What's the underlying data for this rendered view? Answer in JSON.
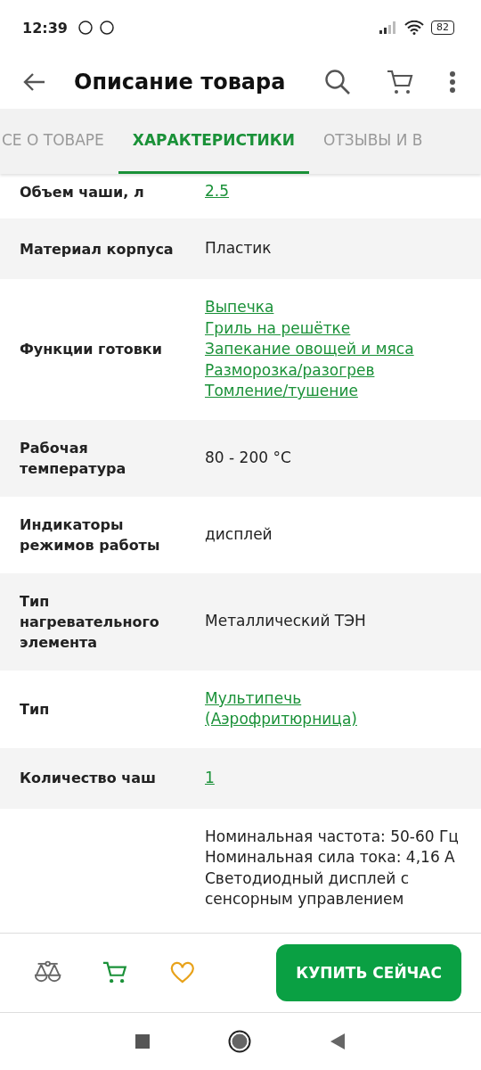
{
  "status_bar": {
    "time": "12:39",
    "battery": "82"
  },
  "app_bar": {
    "title": "Описание товара"
  },
  "tabs": [
    {
      "label": "СЕ О ТОВАРЕ",
      "selected": false
    },
    {
      "label": "ХАРАКТЕРИСТИКИ",
      "selected": true
    },
    {
      "label": "ОТЗЫВЫ И В",
      "selected": false
    }
  ],
  "specs": [
    {
      "name": "Объем чаши, л",
      "values": [
        {
          "text": "2.5",
          "kind": "link"
        }
      ]
    },
    {
      "name": "Материал корпуса",
      "values": [
        {
          "text": "Пластик",
          "kind": "text"
        }
      ]
    },
    {
      "name": "Функции готовки",
      "values": [
        {
          "text": "Выпечка",
          "kind": "link"
        },
        {
          "text": "Гриль на решётке",
          "kind": "link"
        },
        {
          "text": "Запекание овощей и мяса",
          "kind": "link"
        },
        {
          "text": "Разморозка/разогрев",
          "kind": "link"
        },
        {
          "text": "Томление/тушение",
          "kind": "link"
        }
      ]
    },
    {
      "name": "Рабочая температура",
      "values": [
        {
          "text": "80 - 200 °C",
          "kind": "text"
        }
      ]
    },
    {
      "name": "Индикаторы режимов работы",
      "values": [
        {
          "text": "дисплей",
          "kind": "text"
        }
      ]
    },
    {
      "name": "Тип нагревательного элемента",
      "values": [
        {
          "text": "Металлический ТЭН",
          "kind": "text"
        }
      ]
    },
    {
      "name": "Тип",
      "values": [
        {
          "text": "Мультипечь (Аэрофритюрница)",
          "kind": "link"
        }
      ]
    },
    {
      "name": "Количество чаш",
      "values": [
        {
          "text": "1",
          "kind": "link"
        }
      ]
    },
    {
      "values": [
        {
          "text": "Номинальная частота: 50-60 Гц",
          "kind": "text"
        },
        {
          "text": "Номинальная сила тока: 4,16 А",
          "kind": "text"
        },
        {
          "text": "Светодиодный дисплей с сенсорным управлением",
          "kind": "text"
        }
      ]
    }
  ],
  "buy_button": "КУПИТЬ СЕЙЧАС"
}
